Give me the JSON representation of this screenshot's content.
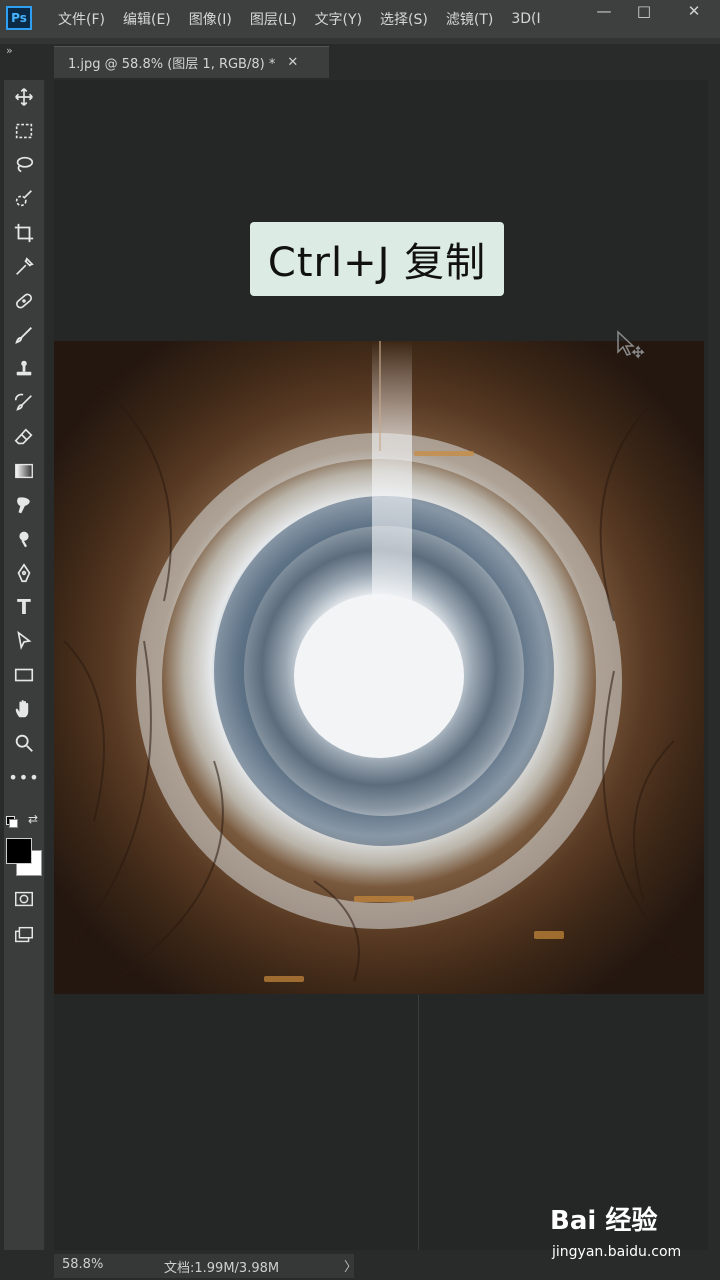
{
  "app": {
    "logo_text": "Ps"
  },
  "menubar": {
    "items": [
      "文件(F)",
      "编辑(E)",
      "图像(I)",
      "图层(L)",
      "文字(Y)",
      "选择(S)",
      "滤镜(T)",
      "3D(I"
    ]
  },
  "window_controls": {
    "minimize": "—",
    "maximize": "□",
    "close": "✕"
  },
  "panel_collapse": "»",
  "document_tab": {
    "title": "1.jpg @ 58.8% (图层 1, RGB/8) *",
    "close": "✕"
  },
  "tools": [
    "move-tool-icon",
    "marquee-tool-icon",
    "lasso-tool-icon",
    "quick-select-tool-icon",
    "crop-tool-icon",
    "eyedropper-tool-icon",
    "healing-brush-tool-icon",
    "brush-tool-icon",
    "clone-stamp-tool-icon",
    "history-brush-tool-icon",
    "eraser-tool-icon",
    "gradient-tool-icon",
    "smudge-tool-icon",
    "dodge-tool-icon",
    "pen-tool-icon",
    "type-tool-icon",
    "path-select-tool-icon",
    "rectangle-tool-icon",
    "hand-tool-icon",
    "zoom-tool-icon",
    "more-tools-icon"
  ],
  "type_tool_glyph": "T",
  "more_tools_glyph": "•••",
  "colors": {
    "foreground": "#000000",
    "background": "#ffffff",
    "tooltip_bg": "#dcebe4"
  },
  "tooltip": {
    "text": "Ctrl+J  复制"
  },
  "status": {
    "zoom": "58.8%",
    "doc_info": "文档:1.99M/3.98M",
    "arrow": "〉"
  },
  "watermark": {
    "logo": "Bai 经验",
    "url": "jingyan.baidu.com"
  }
}
